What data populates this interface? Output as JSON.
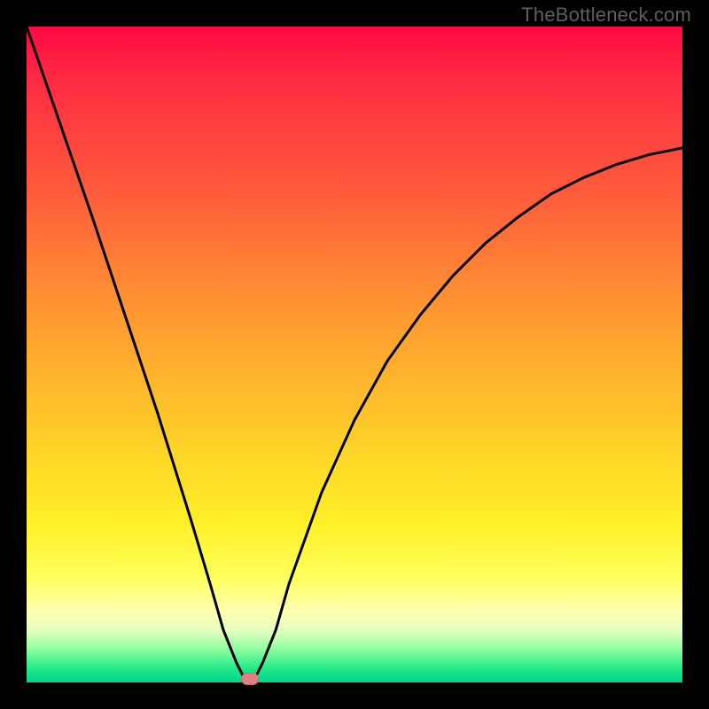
{
  "watermark": "TheBottleneck.com",
  "colors": {
    "black": "#000000",
    "curve": "#000000",
    "marker": "#e08080",
    "watermark": "#5f5f5f"
  },
  "chart_data": {
    "type": "line",
    "title": "",
    "xlabel": "",
    "ylabel": "",
    "xlim": [
      0,
      100
    ],
    "ylim": [
      0,
      100
    ],
    "grid": false,
    "legend": false,
    "annotations": [
      "TheBottleneck.com"
    ],
    "series": [
      {
        "name": "bottleneck-curve",
        "x": [
          0,
          5,
          10,
          15,
          20,
          25,
          28,
          30,
          32,
          33,
          34,
          35,
          36,
          38,
          40,
          45,
          50,
          55,
          60,
          65,
          70,
          75,
          80,
          85,
          90,
          95,
          100
        ],
        "values": [
          100,
          85.5,
          71,
          56,
          41,
          25,
          15,
          8,
          3,
          1,
          0,
          1,
          3,
          8,
          15,
          29,
          40,
          49,
          56,
          62,
          67,
          71,
          74.5,
          77,
          79,
          80.5,
          81.5
        ]
      }
    ],
    "marker": {
      "x": 34,
      "y": 0
    }
  }
}
